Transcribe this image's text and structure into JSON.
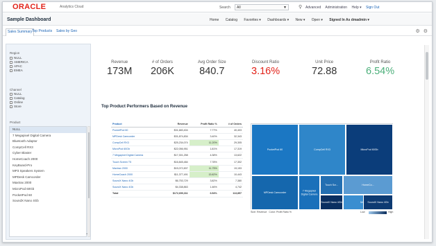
{
  "topbar": {
    "logo": "ORACLE",
    "product": "Analytics Cloud",
    "search_label": "Search",
    "search_value": "All",
    "links": [
      "Advanced",
      "Administration",
      "Help ▾",
      "Sign Out"
    ]
  },
  "header": {
    "title": "Sample Dashboard",
    "menu": [
      "Home",
      "Catalog",
      "Favorites ▾",
      "Dashboards ▾",
      "New ▾",
      "Open ▾"
    ],
    "signed_in": "Signed In As dmadmin ▾"
  },
  "tabs": [
    "Sales Summary",
    "Top Products",
    "Sales by Geo"
  ],
  "prompts": {
    "region": {
      "label": "Region",
      "options": [
        "NULL",
        "AMERICA",
        "APAC",
        "EMEA"
      ]
    },
    "channel": {
      "label": "Channel",
      "options": [
        "NULL",
        "Catalog",
        "Online",
        "Store"
      ]
    },
    "product": {
      "label": "Product",
      "items": [
        "NULL",
        "7 Megapixel Digital Camera",
        "Bluetooth Adaptor",
        "CompCell RX3",
        "Cyber Blaster",
        "HomeCoach 2000",
        "KeyBoard-Pro",
        "MP3 Speakers System",
        "MPDesk Camcorder",
        "Maxtrax 2000",
        "MicroPod 60Gb",
        "PocketPod 60",
        "SoundX Nano 4Gb"
      ]
    }
  },
  "kpis": [
    {
      "label": "Revenue",
      "value": "173M"
    },
    {
      "label": "# of Orders",
      "value": "206K"
    },
    {
      "label": "Avg Order Size",
      "value": "840.7"
    },
    {
      "label": "Discount Ratio",
      "value": "3.16%",
      "color": "#e2231a"
    },
    {
      "label": "Unit Price",
      "value": "72.88"
    },
    {
      "label": "Profit Ratio",
      "value": "6.54%",
      "color": "#4caf7a"
    }
  ],
  "section_title": "Top Product Performers Based on Revenue",
  "table": {
    "headers": [
      "Product",
      "Revenue",
      "Profit Ratio %",
      "# of Orders"
    ],
    "rows": [
      [
        "PocketPod 60",
        "$31,683,404",
        "7.77%",
        "40,403"
      ],
      [
        "MPDesk Camcorder",
        "$31,874,834",
        "3.40%",
        "32,343"
      ],
      [
        "CompCell RX3",
        "$25,234,074",
        "11.20%",
        "29,305"
      ],
      [
        "MicroPod 60Gb",
        "$22,056,951",
        "1.81%",
        "17,319"
      ],
      [
        "7 Megapixel Digital Camera",
        "$17,301,258",
        "4.38%",
        "13,622"
      ],
      [
        "Touch Screen T5",
        "$16,845,484",
        "7.78%",
        "17,302"
      ],
      [
        "Maxtrax 2000",
        "$15,072,837",
        "11.75%",
        "19,153"
      ],
      [
        "HomeCoach 2000",
        "$11,377,491",
        "13.62%",
        "10,443"
      ],
      [
        "SoundX Nano 4Gb",
        "$6,753,729",
        "3.82%",
        "7,380"
      ],
      [
        "SoundX Nano 4Gb",
        "$4,338,863",
        "1.46%",
        "4,742"
      ]
    ],
    "highlight": [
      [
        2,
        2
      ],
      [
        6,
        2
      ],
      [
        7,
        2
      ]
    ],
    "total": [
      "Total",
      "$172,690,311",
      "6.54%",
      "113,857"
    ]
  },
  "treemap": {
    "tiles": [
      {
        "label": "PocketPod 60",
        "color": "#1b77c3"
      },
      {
        "label": "CompCell RX3",
        "color": "#2f86c9"
      },
      {
        "label": "MicroPod 60Gb",
        "color": "#0b3d7a"
      },
      {
        "label": "MPDesk Camcorder",
        "color": "#1567ad"
      },
      {
        "label": "7 Megapixel Digital Camera",
        "color": "#1a70ba"
      },
      {
        "label": "Touch Scr...",
        "color": "#236fb2"
      },
      {
        "label": "HomeCo...",
        "color": "#5b9bd2"
      },
      {
        "label": "Maxtrax 2000",
        "color": "#3a8ed0"
      },
      {
        "label": "SoundX Nano 4Gb",
        "color": "#0a2f61"
      },
      {
        "label": "SoundX Nano 4Gb",
        "color": "#0d3a72"
      }
    ],
    "legend_size": "Size: Revenue",
    "legend_color": "Color: Profit Ratio %",
    "legend_low": "Low",
    "legend_high": "High"
  }
}
